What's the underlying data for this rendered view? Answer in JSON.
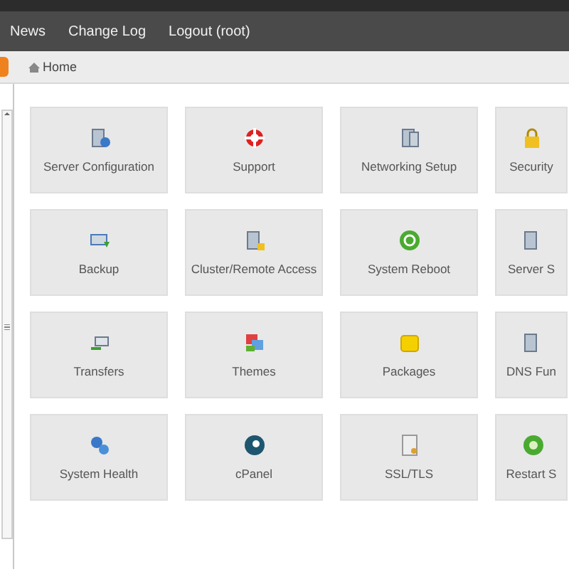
{
  "nav": {
    "links": [
      "News",
      "Change Log",
      "Logout (root)"
    ]
  },
  "breadcrumb": {
    "label": "Home"
  },
  "tiles": [
    {
      "label": "Server Configuration"
    },
    {
      "label": "Support"
    },
    {
      "label": "Networking Setup"
    },
    {
      "label": "Security"
    },
    {
      "label": "Backup"
    },
    {
      "label": "Cluster/Remote Access"
    },
    {
      "label": "System Reboot"
    },
    {
      "label": "Server S"
    },
    {
      "label": "Transfers"
    },
    {
      "label": "Themes"
    },
    {
      "label": "Packages"
    },
    {
      "label": "DNS Fun"
    },
    {
      "label": "System Health"
    },
    {
      "label": "cPanel"
    },
    {
      "label": "SSL/TLS"
    },
    {
      "label": "Restart S"
    }
  ]
}
